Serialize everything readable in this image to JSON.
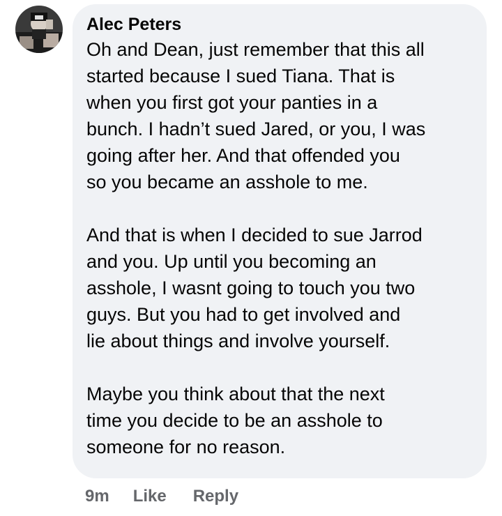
{
  "comment": {
    "author": "Alec Peters",
    "paragraphs": [
      "Oh and Dean, just remember that this all\nstarted because I sued Tiana.  That is\nwhen you first got your panties in a\nbunch.  I hadn’t sued Jared, or you, I was\ngoing after her.  And that offended you\nso you became an asshole to me.",
      "And that is when I decided to sue Jarrod\nand you. Up until you becoming an\nasshole, I wasnt going to touch you two\nguys.  But you had to get involved and\nlie about things and involve yourself.",
      "Maybe you think about that the next\ntime you decide to be an asshole to\nsomeone for no reason."
    ]
  },
  "actions": {
    "time": "9m",
    "like": "Like",
    "reply": "Reply"
  },
  "colors": {
    "bubble": "#f0f2f5",
    "text": "#050505",
    "meta": "#65676b"
  },
  "icons": {
    "avatar": "profile-photo"
  }
}
